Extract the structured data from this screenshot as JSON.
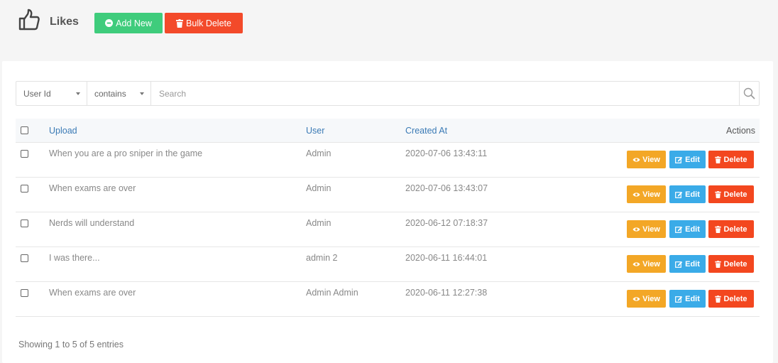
{
  "header": {
    "title": "Likes",
    "add_label": "Add New",
    "bulk_label": "Bulk Delete"
  },
  "filter": {
    "field": "User Id",
    "operator": "contains",
    "placeholder": "Search"
  },
  "table": {
    "columns": {
      "upload": "Upload",
      "user": "User",
      "created": "Created At",
      "actions": "Actions"
    },
    "rows": [
      {
        "upload": "When you are a pro sniper in the game",
        "user": "Admin",
        "created": "2020-07-06 13:43:11"
      },
      {
        "upload": "When exams are over",
        "user": "Admin",
        "created": "2020-07-06 13:43:07"
      },
      {
        "upload": "Nerds will understand",
        "user": "Admin",
        "created": "2020-06-12 07:18:37"
      },
      {
        "upload": "I was there...",
        "user": "admin 2",
        "created": "2020-06-11 16:44:01"
      },
      {
        "upload": "When exams are over",
        "user": "Admin Admin",
        "created": "2020-06-11 12:27:38"
      }
    ],
    "view_label": "View",
    "edit_label": "Edit",
    "delete_label": "Delete"
  },
  "footer": {
    "info": "Showing 1 to 5 of 5 entries"
  },
  "colors": {
    "add": "#3fcc7c",
    "bulk_delete": "#f34a2a",
    "view": "#f3a726",
    "edit": "#3aabe8",
    "delete": "#f3471f",
    "link": "#3a7ab5"
  },
  "icons": {
    "title": "thumbs-up-icon",
    "add": "plus-circle-icon",
    "bulk": "trash-icon",
    "search": "search-icon",
    "view": "eye-icon",
    "edit": "edit-icon",
    "delete": "trash-icon"
  }
}
